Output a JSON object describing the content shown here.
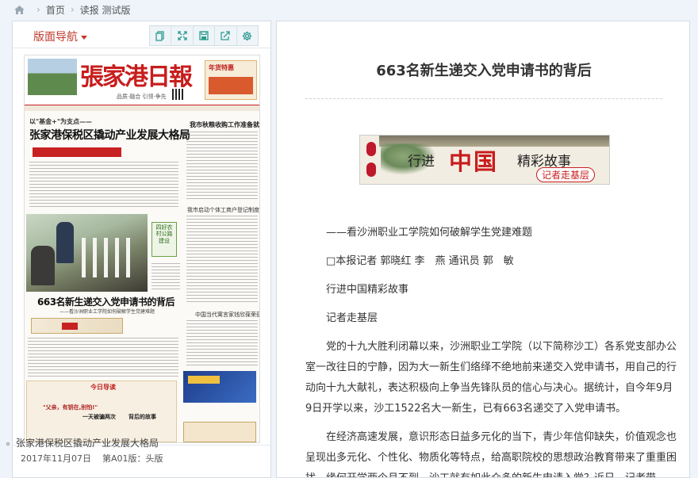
{
  "breadcrumb": {
    "home": "首页",
    "current": "读报 测试版"
  },
  "left_panel": {
    "nav_title": "版面导航",
    "toolbar": [
      "copy-icon",
      "expand-icon",
      "save-icon",
      "share-icon",
      "settings-icon"
    ],
    "newspaper": {
      "masthead": "張家港日報",
      "ad_title": "年货特惠",
      "slogan": "品质·融合 引领·争先",
      "kicker": "以\"基金+\"为支点——",
      "headline1": "张家港保税区撬动产业发展大格局",
      "side_tag": "四好农村公路建设",
      "right_headline": "我市秋粮收购工作准备就绪",
      "right_headline2": "我市启动个体工商户登记制度改革",
      "right_headline3": "中国当代寓言家钱欣葆荣获金骆驼奖",
      "headline2": "663名新生递交入党申请书的背后",
      "subhead2": "——看沙洲职业工学院如何破解学生党建难题",
      "guide_title": "今日导读",
      "guide_quote": "\"父亲，有钥在,别怕!\"",
      "guide_item1": "一天被骗两次",
      "guide_item2": "背后的故事"
    },
    "footer_date": "2017年11月07日",
    "footer_page": "第A01版：头版",
    "article_link": "张家港保税区撬动产业发展大格局"
  },
  "article": {
    "title": "663名新生递交入党申请书的背后",
    "banner": {
      "word1": "行进",
      "word2": "中国",
      "word3": "精彩故事",
      "stamp": "记者走基层"
    },
    "paragraphs": [
      "——看沙洲职业工学院如何破解学生党建难题",
      "□本报记者 郭晓红 李　燕 通讯员 郭　敏",
      "行进中国精彩故事",
      "记者走基层",
      "党的十九大胜利闭幕以来，沙洲职业工学院（以下简称沙工）各系党支部办公室一改往日的宁静，因为大一新生们络绎不绝地前来递交入党申请书，用自己的行动向十九大献礼，表达积极向上争当先锋队员的信心与决心。据统计，自今年9月9日开学以来，沙工1522名大一新生，已有663名递交了入党申请书。",
      "在经济高速发展，意识形态日益多元化的当下，青少年信仰缺失，价值观念也呈现出多元化、个性化、物质化等特点，给高职院校的思想政治教育带来了重重困扰。缘何开学两个月不到，沙工就有如此众多的新生申请入党？近日，记者带"
    ]
  },
  "colors": {
    "accent_red": "#c0392b",
    "masthead_red": "#c81d1d",
    "background": "#eef4fa"
  }
}
